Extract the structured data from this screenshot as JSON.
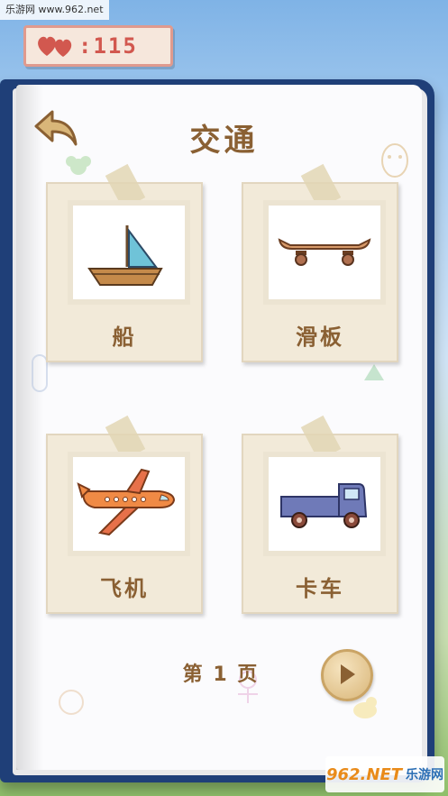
{
  "watermark_top": "乐游网 www.962.net",
  "hearts": {
    "count": ":115"
  },
  "title": "交通",
  "cards": [
    {
      "label": "船",
      "image": "sailboat"
    },
    {
      "label": "滑板",
      "image": "skateboard"
    },
    {
      "label": "飞机",
      "image": "airplane"
    },
    {
      "label": "卡车",
      "image": "truck"
    }
  ],
  "page_number": "第 1 页",
  "watermark_bottom": {
    "logo": "962.NET",
    "text": "乐游网"
  },
  "icons": {
    "back": "back-arrow-icon",
    "next": "play-icon",
    "heart": "hearts-icon"
  },
  "colors": {
    "accent": "#8a6033",
    "heart": "#d2584f",
    "book_cover": "#1f3f78"
  }
}
